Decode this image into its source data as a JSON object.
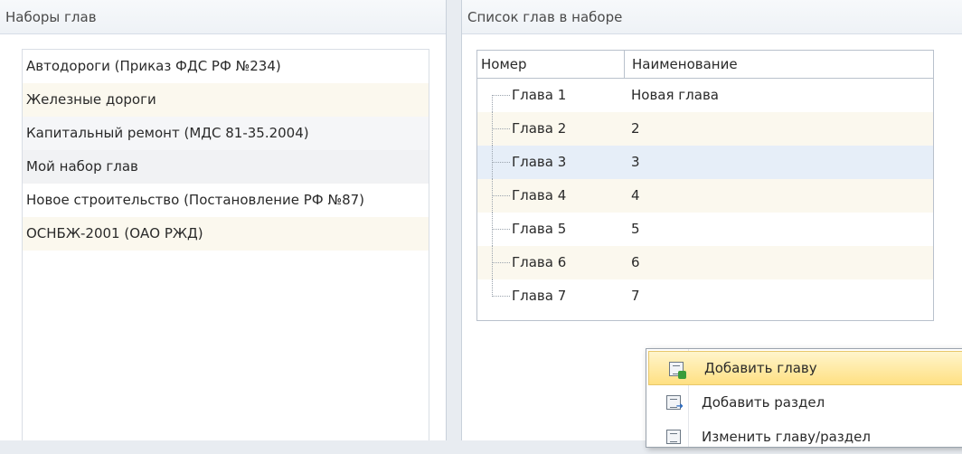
{
  "left_panel": {
    "title": "Наборы глав",
    "items": [
      {
        "label": "Автодороги (Приказ ФДС РФ №234)"
      },
      {
        "label": "Железные дороги"
      },
      {
        "label": "Капитальный ремонт (МДС 81-35.2004)"
      },
      {
        "label": "Мой набор глав"
      },
      {
        "label": "Новое строительство (Постановление РФ №87)"
      },
      {
        "label": "ОСНБЖ-2001 (ОАО РЖД)"
      }
    ]
  },
  "right_panel": {
    "title": "Список глав в наборе",
    "grid": {
      "col_number": "Номер",
      "col_name": "Наименование",
      "rows": [
        {
          "num": "Глава 1",
          "name": "Новая глава"
        },
        {
          "num": "Глава 2",
          "name": "2"
        },
        {
          "num": "Глава 3",
          "name": "3"
        },
        {
          "num": "Глава 4",
          "name": "4"
        },
        {
          "num": "Глава 5",
          "name": "5"
        },
        {
          "num": "Глава 6",
          "name": "6"
        },
        {
          "num": "Глава 7",
          "name": "7"
        }
      ]
    }
  },
  "context_menu": {
    "items": [
      {
        "label": "Добавить главу",
        "icon": "add-chapter-icon"
      },
      {
        "label": "Добавить раздел",
        "icon": "add-section-icon"
      },
      {
        "label": "Изменить главу/раздел",
        "icon": "edit-chapter-icon"
      }
    ]
  }
}
